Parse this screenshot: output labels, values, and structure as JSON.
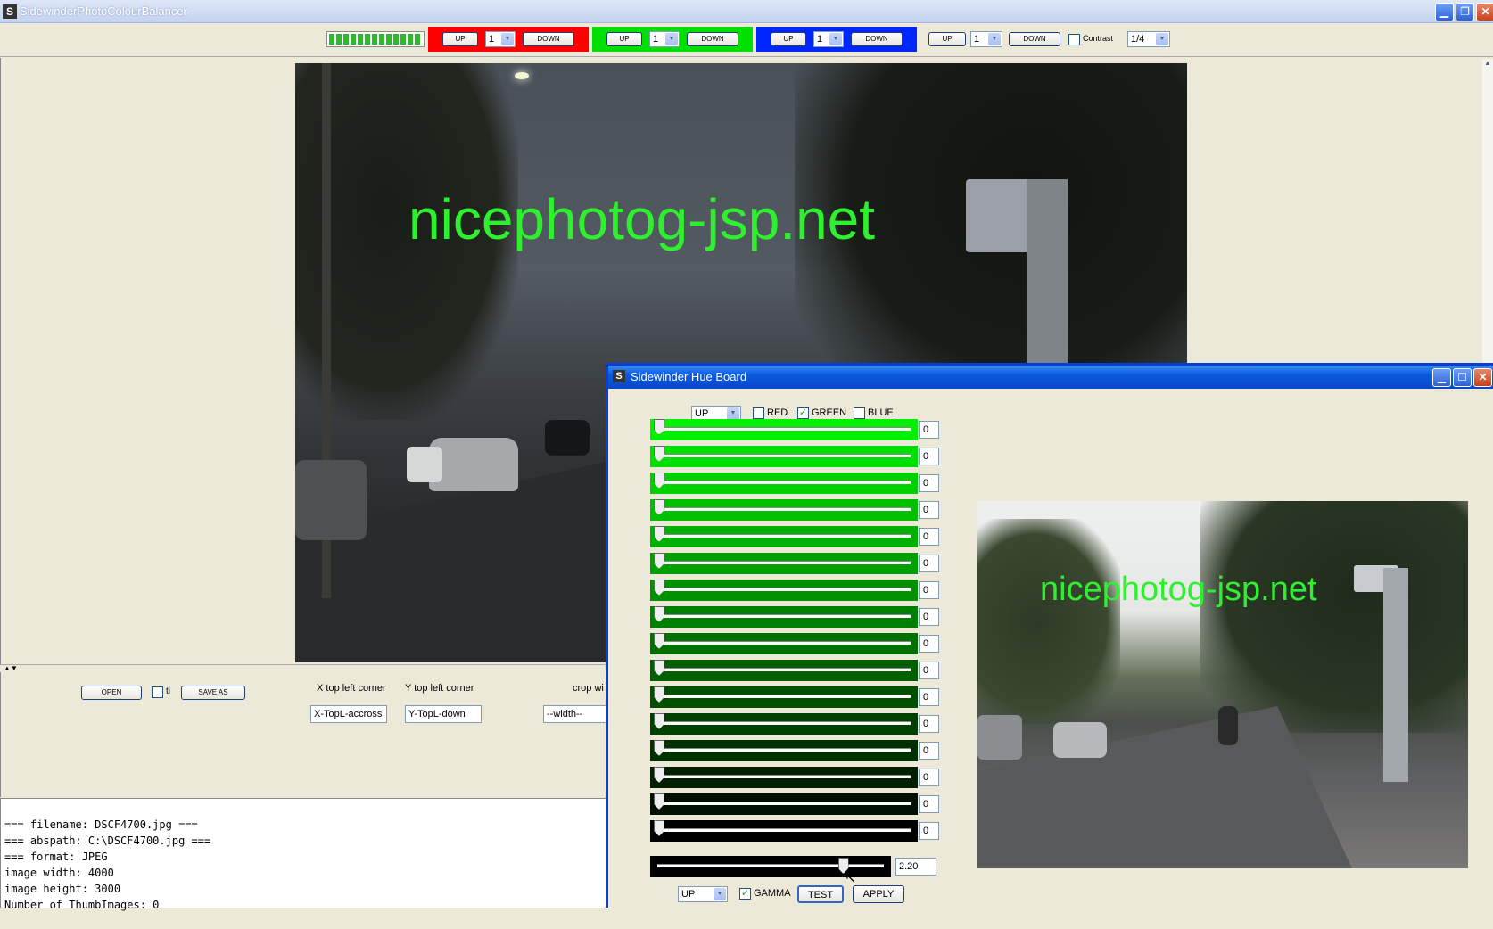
{
  "main_window": {
    "title": "SidewinderPhotoColourBalancer"
  },
  "toolbar": {
    "red": {
      "up": "UP",
      "value": "1",
      "down": "DOWN"
    },
    "green": {
      "up": "UP",
      "value": "1",
      "down": "DOWN"
    },
    "blue": {
      "up": "UP",
      "value": "1",
      "down": "DOWN"
    },
    "contrast": {
      "up": "UP",
      "value": "1",
      "down": "DOWN",
      "label": "Contrast"
    },
    "scale": "1/4",
    "colors": {
      "red": "#ff0000",
      "green": "#00e000",
      "blue": "#0026ff"
    }
  },
  "photo": {
    "watermark": "nicephotog-jsp.net"
  },
  "controls": {
    "open": "OPEN",
    "ti_label": "ti",
    "save_as": "SAVE AS",
    "x_label": "X top left corner",
    "y_label": "Y top left corner",
    "crop_label": "crop wi",
    "x_placeholder": "X-TopL-accross",
    "y_placeholder": "Y-TopL-down",
    "width_placeholder": "--width--"
  },
  "console": {
    "lines": [
      "=== filename: DSCF4700.jpg ===",
      "=== abspath: C:\\DSCF4700.jpg ===",
      "=== format: JPEG",
      "image width: 4000",
      "image height: 3000",
      "Number of ThumbImages: 0"
    ]
  },
  "hue_board": {
    "title": "Sidewinder Hue Board",
    "direction": "UP",
    "channels": {
      "red": "RED",
      "green": "GREEN",
      "blue": "BLUE"
    },
    "green_checked": true,
    "slider_values": [
      "0",
      "0",
      "0",
      "0",
      "0",
      "0",
      "0",
      "0",
      "0",
      "0",
      "0",
      "0",
      "0",
      "0",
      "0",
      "0"
    ],
    "gamma_value": "2.20",
    "gamma_fraction": 0.83,
    "bottom_direction": "UP",
    "gamma_label": "GAMMA",
    "test": "TEST",
    "apply": "APPLY",
    "preview_watermark": "nicephotog-jsp.net"
  }
}
